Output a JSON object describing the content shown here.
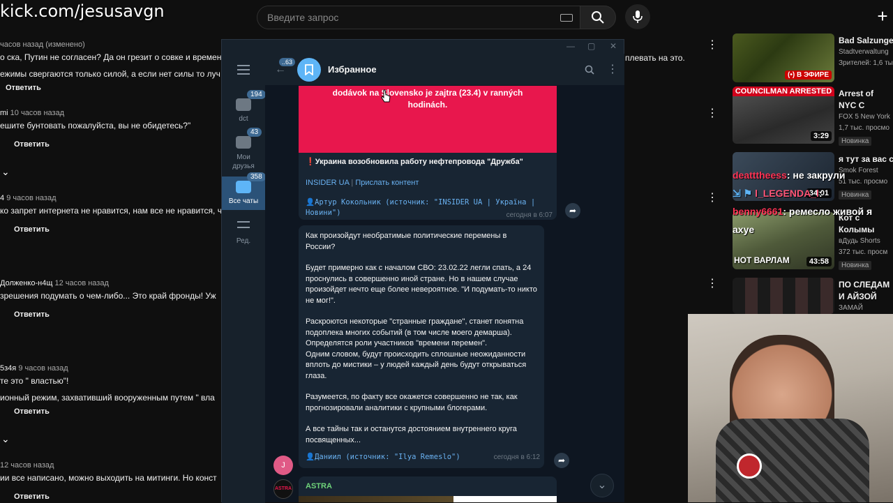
{
  "watermark": "kick.com/jesusavgn",
  "youtube": {
    "search_placeholder": "Введите запрос"
  },
  "comments": [
    {
      "author": "",
      "time": "часов назад (изменено)",
      "text": "о ска, Путин не согласен? Да он грезит о совке и времен",
      "reply": "Ответить"
    },
    {
      "author": "",
      "time": "",
      "text": "ежимы свергаются только силой, а если нет силы то луч",
      "reply": ""
    },
    {
      "author": "mi",
      "time": "10 часов назад",
      "text": "ешите бунтовать пожалуйста, вы не обидетесь?\"",
      "reply": "Ответить"
    },
    {
      "author": "4",
      "time": "9 часов назад",
      "text": "ко запрет интернета не нравится, нам все не нравится, ч",
      "reply": "Ответить"
    },
    {
      "author": "Долженко-н4щ",
      "time": "12 часов назад",
      "text": "зрешения подумать о чем-либо... Это край фронды! Уж",
      "reply": "Ответить"
    },
    {
      "author": "5з4я",
      "time": "9 часов назад",
      "text": "те это \" властью\"!",
      "reply": ""
    },
    {
      "author": "",
      "time": "",
      "text": "ионный режим,  захвативший вооруженным путем \" вла",
      "reply": "Ответить"
    },
    {
      "author": "",
      "time": "12 часов назад",
      "text": "ии все написано, можно выходить на митинги. Но конст",
      "reply": "Ответить"
    }
  ],
  "right_comment_fragment": "плевать на это.",
  "recommendations": [
    {
      "title": "Bad Salzunger",
      "channel": "Stadtverwaltung",
      "views": "Зрителей: 1,6 ты",
      "badge": "",
      "duration": "",
      "live": "В ЭФИРЕ"
    },
    {
      "title": "Arrest of NYC C caught on cam",
      "channel": "FOX 5 New York",
      "views": "1,7 тыс. просмо",
      "badge": "Новинка",
      "duration": "3:29",
      "thumb_text": "COUNCILMAN ARRESTED"
    },
    {
      "title": "я тут за вас су",
      "channel": "Smok Forest",
      "views": "51 тыс. просмо",
      "badge": "Новинка",
      "duration": "34:01"
    },
    {
      "title": "Кот с Колымы Париже",
      "channel": "вДудь Shorts",
      "views": "372 тыс. просм",
      "badge": "Новинка",
      "duration": "43:58",
      "thumb_text": "НОТ ВАРЛАМ"
    },
    {
      "title": "ПО СЛЕДАМ И АЙЗОЙ",
      "channel": "ЗАМАЙ",
      "views": "",
      "badge": "",
      "duration": ""
    }
  ],
  "chat": [
    {
      "user": "deatttheess",
      "msg": ": не закрули",
      "color": "#ff3355"
    },
    {
      "user": "l_LEGENDA_l",
      "msg": ":",
      "color": "#ff5577"
    },
    {
      "user": "benny6661",
      "msg": ": ремесло живой я axye",
      "color": "#ff3355"
    }
  ],
  "telegram": {
    "back_count": "63",
    "chat_title": "Избранное",
    "folders": [
      {
        "label": "dct",
        "count": "194"
      },
      {
        "label": "Мои друзья",
        "count": "43"
      },
      {
        "label": "Все чаты",
        "count": "358"
      },
      {
        "label": "Ред.",
        "count": ""
      }
    ],
    "image_caption": "dodávok na Slovensko je zajtra (23.4) v ranných hodinách.",
    "post1": {
      "headline": "Украина возобновила работу нефтепровода \"Дружба\"",
      "source_link": "INSIDER UA",
      "separator": "|",
      "submit_link": "Прислать контент",
      "signature": "👤Артур Кокольник (источник: \"INSIDER UA | Україна | Новини\")",
      "time": "сегодня в 6:07"
    },
    "post2": {
      "p1": "Как произойдут необратимые политические перемены в России?",
      "p2": "Будет примерно как с началом СВО: 23.02.22 легли спать, а 24 проснулись в совершенно иной стране. Но в нашем случае произойдет нечто еще более невероятное. \"И подумать-то никто не мог!\".",
      "p3": "Раскроются некоторые \"странные граждане\", станет понятна подоплека многих событий (в том числе моего демарша). Определятся роли участников \"времени перемен\".\nОдним словом, будут происходить сплошные неожиданности вплоть до мистики – у людей каждый день будут открываться глаза.",
      "p4": "Разумеется, по факту все окажется совершенно не так, как прогнозировали аналитики с крупными блогерами.",
      "p5": "А все тайны так и останутся достоянием внутреннего круга посвященных...",
      "signature": "👤Даниил (источник: \"Ilya Remeslo\")",
      "time": "сегодня в 6:12",
      "avatar_letter": "J"
    },
    "post3": {
      "channel": "ASTRA"
    }
  },
  "colors": {
    "tg_bg": "#0e1621",
    "tg_panel": "#17212b",
    "bubble": "#182533",
    "link": "#6ab2f2",
    "banner": "#e8174d"
  }
}
